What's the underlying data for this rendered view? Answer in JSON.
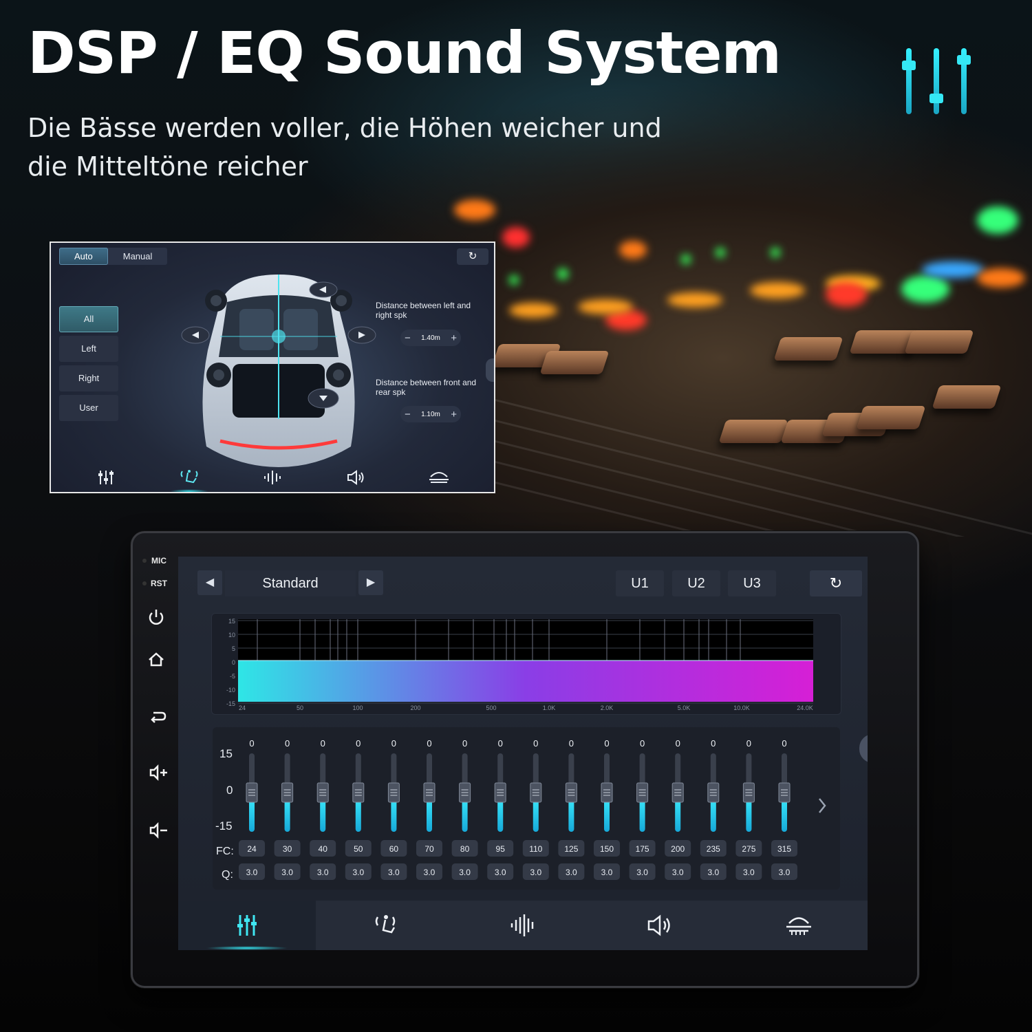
{
  "header": {
    "title": "DSP / EQ Sound System",
    "subtitle_line1": "Die Bässe werden voller, die Höhen weicher und",
    "subtitle_line2": "die Mitteltöne reicher"
  },
  "colors": {
    "accent": "#1fd8e6",
    "eq_start": "#2ee6e6",
    "eq_end": "#d61fd6",
    "panel": "#242a36"
  },
  "dsp_window": {
    "mode_tabs": [
      "Auto",
      "Manual"
    ],
    "active_mode": "Auto",
    "reset_icon": "refresh-icon",
    "side_buttons": [
      "All",
      "Left",
      "Right",
      "User"
    ],
    "active_side": "All",
    "distance_lr_label": "Distance between left and right spk",
    "distance_lr_value": "1.40m",
    "distance_fr_label": "Distance between front and rear spk",
    "distance_fr_value": "1.10m",
    "minus": "−",
    "plus": "+",
    "nav_icons": [
      "equalizer-icon",
      "seat-position-icon",
      "soundwave-icon",
      "speaker-icon",
      "sound-field-icon"
    ],
    "active_nav": "seat-position-icon"
  },
  "head_unit": {
    "hardware": {
      "mic": "MIC",
      "rst": "RST",
      "buttons": [
        "power-icon",
        "home-icon",
        "back-icon",
        "volume-up-icon",
        "volume-down-icon"
      ]
    },
    "preset": {
      "name": "Standard",
      "prev": "◀",
      "next": "▶"
    },
    "user_presets": [
      "U1",
      "U2",
      "U3"
    ],
    "reset_icon": "refresh-icon",
    "graph": {
      "y_ticks": [
        "15",
        "10",
        "5",
        "0",
        "-5",
        "-10",
        "-15"
      ],
      "x_ticks": [
        "24",
        "50",
        "100",
        "200",
        "500",
        "1.0K",
        "2.0K",
        "5.0K",
        "10.0K",
        "24.0K"
      ]
    },
    "eq": {
      "scale": {
        "top": "15",
        "mid": "0",
        "bottom": "-15"
      },
      "fc_label": "FC:",
      "q_label": "Q:",
      "bands": [
        {
          "gain": "0",
          "fc": "24",
          "q": "3.0"
        },
        {
          "gain": "0",
          "fc": "30",
          "q": "3.0"
        },
        {
          "gain": "0",
          "fc": "40",
          "q": "3.0"
        },
        {
          "gain": "0",
          "fc": "50",
          "q": "3.0"
        },
        {
          "gain": "0",
          "fc": "60",
          "q": "3.0"
        },
        {
          "gain": "0",
          "fc": "70",
          "q": "3.0"
        },
        {
          "gain": "0",
          "fc": "80",
          "q": "3.0"
        },
        {
          "gain": "0",
          "fc": "95",
          "q": "3.0"
        },
        {
          "gain": "0",
          "fc": "110",
          "q": "3.0"
        },
        {
          "gain": "0",
          "fc": "125",
          "q": "3.0"
        },
        {
          "gain": "0",
          "fc": "150",
          "q": "3.0"
        },
        {
          "gain": "0",
          "fc": "175",
          "q": "3.0"
        },
        {
          "gain": "0",
          "fc": "200",
          "q": "3.0"
        },
        {
          "gain": "0",
          "fc": "235",
          "q": "3.0"
        },
        {
          "gain": "0",
          "fc": "275",
          "q": "3.0"
        },
        {
          "gain": "0",
          "fc": "315",
          "q": "3.0"
        }
      ],
      "next_page_icon": "chevron-right-icon"
    },
    "nav_icons": [
      "equalizer-icon",
      "seat-position-icon",
      "soundwave-icon",
      "speaker-icon",
      "sound-field-icon"
    ],
    "active_nav": "equalizer-icon"
  }
}
